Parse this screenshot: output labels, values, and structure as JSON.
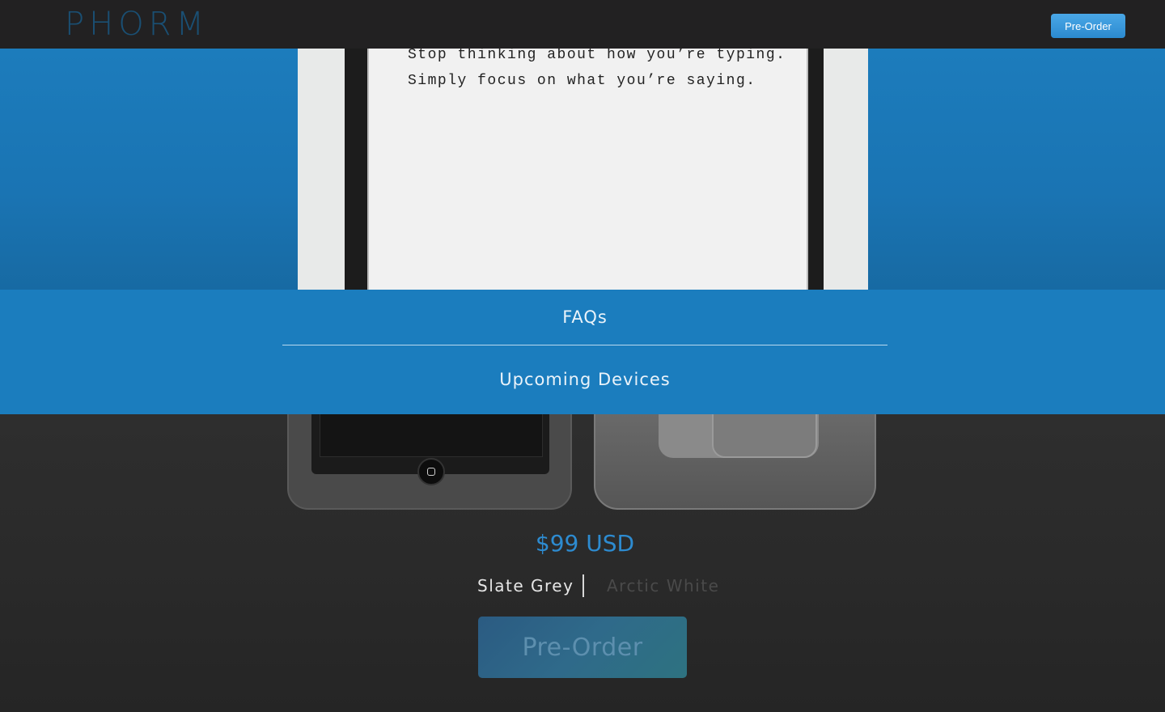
{
  "nav": {
    "logo": "PHORM",
    "preorder_label": "Pre-Order"
  },
  "hero": {
    "line1": "Stop thinking about how you’re typing.",
    "line2": "Simply focus on what you’re saying."
  },
  "menu": {
    "items": [
      {
        "label": "FAQs"
      },
      {
        "label": "Upcoming Devices"
      }
    ]
  },
  "product": {
    "price": "$99 USD",
    "colors": [
      {
        "label": "Slate Grey",
        "selected": true
      },
      {
        "label": "Arctic White",
        "selected": false
      }
    ],
    "preorder_label": "Pre-Order"
  },
  "colors": {
    "accent": "#1b7dbe",
    "price": "#2d8bd0",
    "nav_bg": "#222122"
  }
}
